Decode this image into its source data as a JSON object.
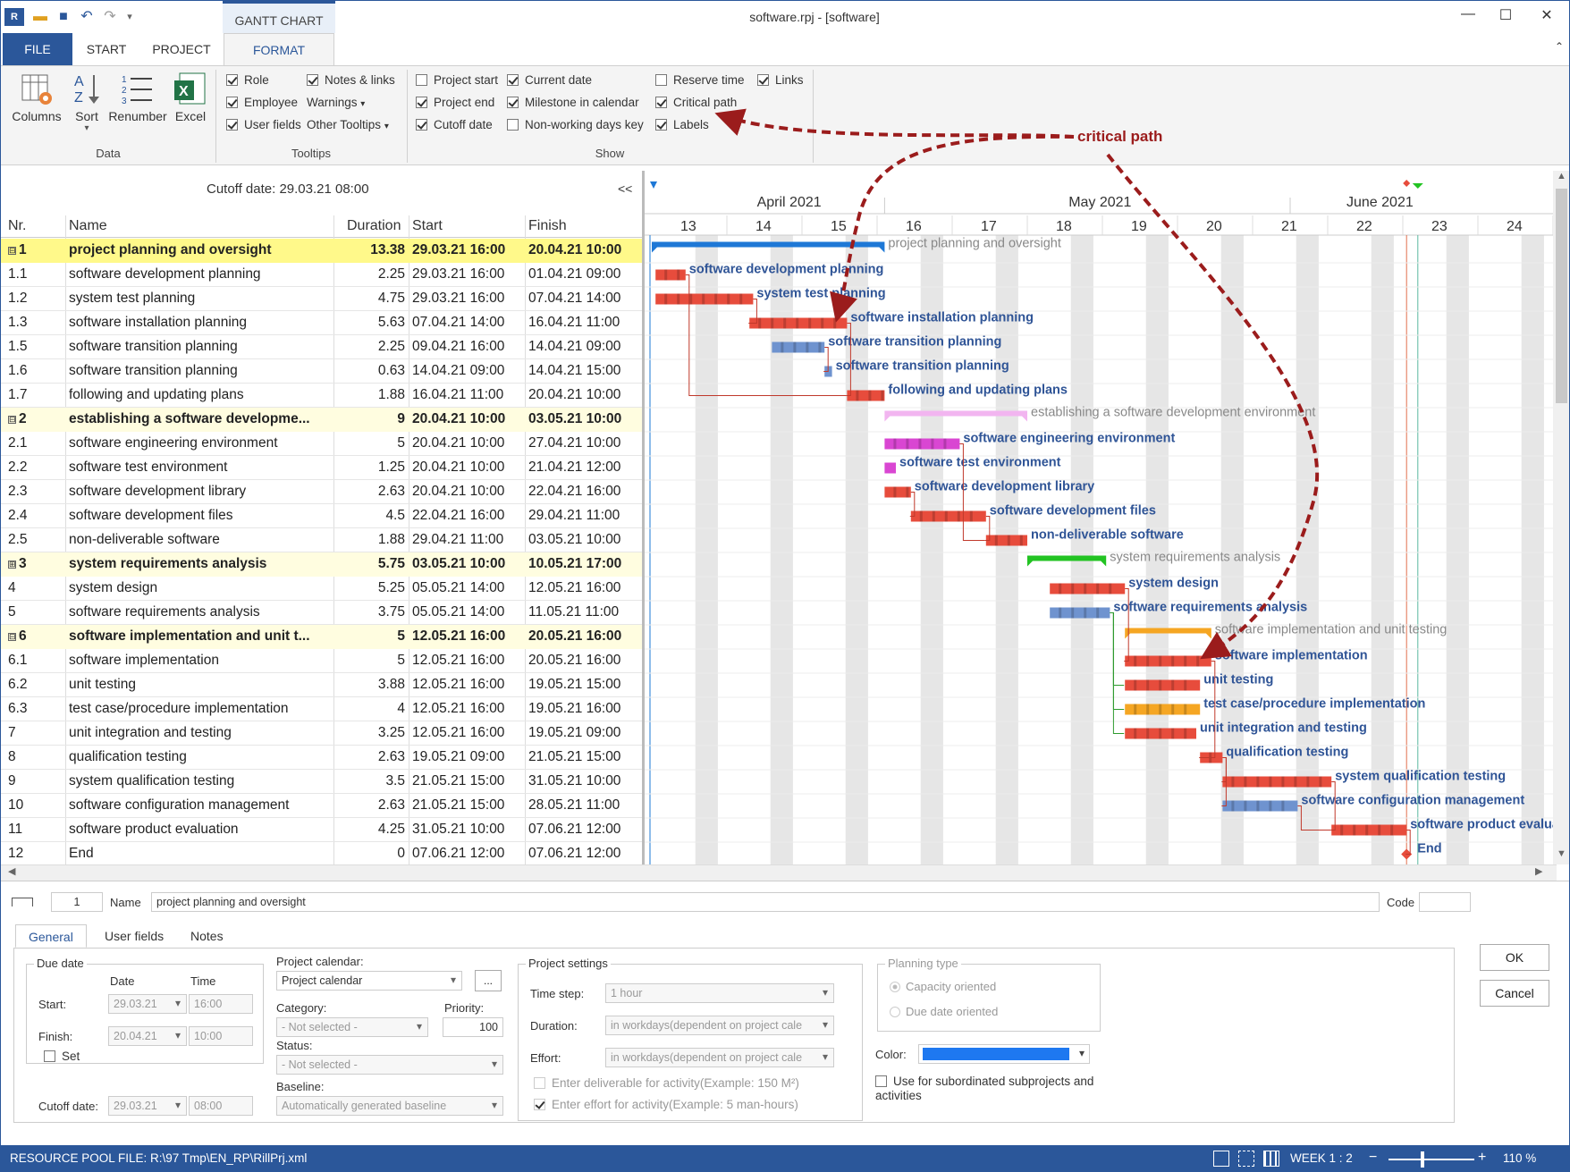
{
  "window": {
    "title": "software.rpj - [software]",
    "context_tab": "GANTT CHART"
  },
  "tabs": [
    "FILE",
    "START",
    "PROJECT",
    "FORMAT"
  ],
  "ribbon": {
    "data_group": {
      "label": "Data",
      "buttons": [
        "Columns",
        "Sort",
        "Renumber",
        "Excel"
      ]
    },
    "tooltips_group": {
      "label": "Tooltips",
      "items": [
        {
          "label": "Role",
          "checked": true
        },
        {
          "label": "Employee",
          "checked": true
        },
        {
          "label": "User fields",
          "checked": true
        },
        {
          "label": "Notes & links",
          "checked": true
        },
        {
          "label": "Warnings",
          "dropdown": true
        },
        {
          "label": "Other Tooltips",
          "dropdown": true
        }
      ]
    },
    "show_group": {
      "label": "Show",
      "items": [
        {
          "label": "Project start",
          "checked": false
        },
        {
          "label": "Project end",
          "checked": true
        },
        {
          "label": "Cutoff date",
          "checked": true
        },
        {
          "label": "Current date",
          "checked": true
        },
        {
          "label": "Milestone in calendar",
          "checked": true
        },
        {
          "label": "Non-working days key",
          "checked": false
        },
        {
          "label": "Reserve time",
          "checked": false
        },
        {
          "label": "Critical path",
          "checked": true
        },
        {
          "label": "Labels",
          "checked": true
        },
        {
          "label": "Links",
          "checked": true
        }
      ]
    }
  },
  "annotation": "critical path",
  "cutoff_label": "Cutoff date: 29.03.21 08:00",
  "collapse_btn": "<<",
  "grid": {
    "headers": [
      "Nr.",
      "Name",
      "Duration",
      "Start",
      "Finish"
    ],
    "rows": [
      {
        "nr": "1",
        "name": "project planning and oversight",
        "dur": "13.38",
        "start": "29.03.21 16:00",
        "finish": "20.04.21 10:00",
        "summary": true,
        "toggle": "⊟"
      },
      {
        "nr": "1.1",
        "name": "software development planning",
        "dur": "2.25",
        "start": "29.03.21 16:00",
        "finish": "01.04.21 09:00"
      },
      {
        "nr": "1.2",
        "name": "system test planning",
        "dur": "4.75",
        "start": "29.03.21 16:00",
        "finish": "07.04.21 14:00"
      },
      {
        "nr": "1.3",
        "name": "software installation planning",
        "dur": "5.63",
        "start": "07.04.21 14:00",
        "finish": "16.04.21 11:00"
      },
      {
        "nr": "1.5",
        "name": "software transition planning",
        "dur": "2.25",
        "start": "09.04.21 16:00",
        "finish": "14.04.21 09:00"
      },
      {
        "nr": "1.6",
        "name": "software transition planning",
        "dur": "0.63",
        "start": "14.04.21 09:00",
        "finish": "14.04.21 15:00"
      },
      {
        "nr": "1.7",
        "name": "following and updating plans",
        "dur": "1.88",
        "start": "16.04.21 11:00",
        "finish": "20.04.21 10:00"
      },
      {
        "nr": "2",
        "name": "establishing a software developme...",
        "dur": "9",
        "start": "20.04.21 10:00",
        "finish": "03.05.21 10:00",
        "summary": true,
        "toggle": "⊟"
      },
      {
        "nr": "2.1",
        "name": "software engineering environment",
        "dur": "5",
        "start": "20.04.21 10:00",
        "finish": "27.04.21 10:00"
      },
      {
        "nr": "2.2",
        "name": "software test environment",
        "dur": "1.25",
        "start": "20.04.21 10:00",
        "finish": "21.04.21 12:00"
      },
      {
        "nr": "2.3",
        "name": "software development library",
        "dur": "2.63",
        "start": "20.04.21 10:00",
        "finish": "22.04.21 16:00"
      },
      {
        "nr": "2.4",
        "name": "software development files",
        "dur": "4.5",
        "start": "22.04.21 16:00",
        "finish": "29.04.21 11:00"
      },
      {
        "nr": "2.5",
        "name": "non-deliverable software",
        "dur": "1.88",
        "start": "29.04.21 11:00",
        "finish": "03.05.21 10:00"
      },
      {
        "nr": "3",
        "name": "system requirements analysis",
        "dur": "5.75",
        "start": "03.05.21 10:00",
        "finish": "10.05.21 17:00",
        "summary": true,
        "toggle": "⊞"
      },
      {
        "nr": "4",
        "name": "system design",
        "dur": "5.25",
        "start": "05.05.21 14:00",
        "finish": "12.05.21 16:00"
      },
      {
        "nr": "5",
        "name": "software requirements analysis",
        "dur": "3.75",
        "start": "05.05.21 14:00",
        "finish": "11.05.21 11:00"
      },
      {
        "nr": "6",
        "name": "software implementation and unit t...",
        "dur": "5",
        "start": "12.05.21 16:00",
        "finish": "20.05.21 16:00",
        "summary": true,
        "toggle": "⊟"
      },
      {
        "nr": "6.1",
        "name": "software implementation",
        "dur": "5",
        "start": "12.05.21 16:00",
        "finish": "20.05.21 16:00"
      },
      {
        "nr": "6.2",
        "name": "unit testing",
        "dur": "3.88",
        "start": "12.05.21 16:00",
        "finish": "19.05.21 15:00"
      },
      {
        "nr": "6.3",
        "name": "test case/procedure implementation",
        "dur": "4",
        "start": "12.05.21 16:00",
        "finish": "19.05.21 16:00"
      },
      {
        "nr": "7",
        "name": "unit integration and testing",
        "dur": "3.25",
        "start": "12.05.21 16:00",
        "finish": "19.05.21 09:00"
      },
      {
        "nr": "8",
        "name": "qualification testing",
        "dur": "2.63",
        "start": "19.05.21 09:00",
        "finish": "21.05.21 15:00"
      },
      {
        "nr": "9",
        "name": "system qualification testing",
        "dur": "3.5",
        "start": "21.05.21 15:00",
        "finish": "31.05.21 10:00"
      },
      {
        "nr": "10",
        "name": "software configuration management",
        "dur": "2.63",
        "start": "21.05.21 15:00",
        "finish": "28.05.21 11:00"
      },
      {
        "nr": "11",
        "name": "software product evaluation",
        "dur": "4.25",
        "start": "31.05.21 10:00",
        "finish": "07.06.21 12:00"
      },
      {
        "nr": "12",
        "name": "End",
        "dur": "0",
        "start": "07.06.21 12:00",
        "finish": "07.06.21 12:00"
      }
    ]
  },
  "gantt": {
    "months": [
      "April 2021",
      "May 2021",
      "June 2021"
    ],
    "weeks": [
      "13",
      "14",
      "15",
      "16",
      "17",
      "18",
      "19",
      "20",
      "21",
      "22",
      "23",
      "24"
    ],
    "tasks": [
      {
        "label": "project planning and oversight",
        "s": 0.0,
        "e": 3.1,
        "kind": "summary",
        "color": "#1e78d6",
        "label_color": "#888"
      },
      {
        "label": "software development planning",
        "s": 0.05,
        "e": 0.45,
        "kind": "bar",
        "color": "#e74c3c"
      },
      {
        "label": "system test planning",
        "s": 0.05,
        "e": 1.35,
        "kind": "bar",
        "color": "#e74c3c"
      },
      {
        "label": "software installation planning",
        "s": 1.3,
        "e": 2.6,
        "kind": "bar",
        "color": "#e74c3c"
      },
      {
        "label": "software transition planning",
        "s": 1.6,
        "e": 2.3,
        "kind": "bar",
        "color": "#6f93cf"
      },
      {
        "label": "software transition planning",
        "s": 2.3,
        "e": 2.4,
        "kind": "bar",
        "color": "#6f93cf"
      },
      {
        "label": "following and updating plans",
        "s": 2.6,
        "e": 3.1,
        "kind": "bar",
        "color": "#e74c3c"
      },
      {
        "label": "establishing a software development environment",
        "s": 3.1,
        "e": 5.0,
        "kind": "summary",
        "color": "#f2b5f0",
        "label_color": "#888"
      },
      {
        "label": "software engineering environment",
        "s": 3.1,
        "e": 4.1,
        "kind": "bar",
        "color": "#d946d2"
      },
      {
        "label": "software test environment",
        "s": 3.1,
        "e": 3.25,
        "kind": "bar",
        "color": "#d946d2"
      },
      {
        "label": "software development library",
        "s": 3.1,
        "e": 3.45,
        "kind": "bar",
        "color": "#e74c3c"
      },
      {
        "label": "software development files",
        "s": 3.45,
        "e": 4.45,
        "kind": "bar",
        "color": "#e74c3c"
      },
      {
        "label": "non-deliverable software",
        "s": 4.45,
        "e": 5.0,
        "kind": "bar",
        "color": "#e74c3c"
      },
      {
        "label": "system requirements analysis",
        "s": 5.0,
        "e": 6.05,
        "kind": "summary",
        "color": "#22c322",
        "label_color": "#888"
      },
      {
        "label": "system design",
        "s": 5.3,
        "e": 6.3,
        "kind": "bar",
        "color": "#e74c3c"
      },
      {
        "label": "software requirements analysis",
        "s": 5.3,
        "e": 6.1,
        "kind": "bar",
        "color": "#6f93cf"
      },
      {
        "label": "software implementation and unit testing",
        "s": 6.3,
        "e": 7.45,
        "kind": "summary",
        "color": "#f5a623",
        "label_color": "#888"
      },
      {
        "label": "software implementation",
        "s": 6.3,
        "e": 7.45,
        "kind": "bar",
        "color": "#e74c3c"
      },
      {
        "label": "unit testing",
        "s": 6.3,
        "e": 7.3,
        "kind": "bar",
        "color": "#e74c3c"
      },
      {
        "label": "test case/procedure implementation",
        "s": 6.3,
        "e": 7.3,
        "kind": "bar",
        "color": "#f5a623"
      },
      {
        "label": "unit integration and testing",
        "s": 6.3,
        "e": 7.25,
        "kind": "bar",
        "color": "#e74c3c"
      },
      {
        "label": "qualification testing",
        "s": 7.3,
        "e": 7.6,
        "kind": "bar",
        "color": "#e74c3c"
      },
      {
        "label": "system qualification testing",
        "s": 7.6,
        "e": 9.05,
        "kind": "bar",
        "color": "#e74c3c"
      },
      {
        "label": "software configuration management",
        "s": 7.6,
        "e": 8.6,
        "kind": "bar",
        "color": "#6f93cf"
      },
      {
        "label": "software product evaluation",
        "s": 9.05,
        "e": 10.05,
        "kind": "bar",
        "color": "#e74c3c"
      },
      {
        "label": "End",
        "s": 10.05,
        "e": 10.05,
        "kind": "milestone",
        "color": "#e74c3c"
      }
    ]
  },
  "detail": {
    "id": "1",
    "name_label": "Name",
    "name": "project planning and oversight",
    "code_label": "Code",
    "tabs": [
      "General",
      "User fields",
      "Notes"
    ],
    "due_date": {
      "title": "Due date",
      "date_h": "Date",
      "time_h": "Time",
      "start_l": "Start:",
      "start_d": "29.03.21",
      "start_t": "16:00",
      "finish_l": "Finish:",
      "finish_d": "20.04.21",
      "finish_t": "10:00",
      "set": "Set"
    },
    "cutoff_l": "Cutoff date:",
    "cutoff_d": "29.03.21",
    "cutoff_t": "08:00",
    "project_calendar_l": "Project calendar:",
    "project_calendar": "Project calendar",
    "calendar_btn": "...",
    "category_l": "Category:",
    "category": "- Not selected -",
    "priority_l": "Priority:",
    "priority": "100",
    "status_l": "Status:",
    "status": "- Not selected -",
    "baseline_l": "Baseline:",
    "baseline": "Automatically generated baseline",
    "settings": {
      "title": "Project settings",
      "time_step_l": "Time step:",
      "time_step": "1 hour",
      "duration_l": "Duration:",
      "duration": "in workdays(dependent on project cale",
      "effort_l": "Effort:",
      "effort": "in workdays(dependent on project cale",
      "deliverable": "Enter deliverable for activity(Example: 150 M²)",
      "effort_cb": "Enter effort for activity(Example: 5 man-hours)"
    },
    "planning": {
      "title": "Planning type",
      "capacity": "Capacity oriented",
      "due": "Due date oriented"
    },
    "color_l": "Color:",
    "color": "#1e78f0",
    "subordinated": "Use for subordinated subprojects and activities",
    "ok": "OK",
    "cancel": "Cancel"
  },
  "status": {
    "resource": "RESOURCE POOL FILE: R:\\97 Tmp\\EN_RP\\RillPrj.xml",
    "week": "WEEK 1 : 2",
    "minus": "−",
    "plus": "+",
    "zoom": "110 %"
  }
}
